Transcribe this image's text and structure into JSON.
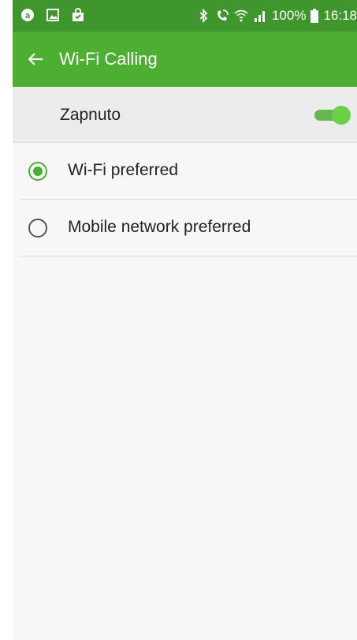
{
  "status_bar": {
    "battery_text": "100%",
    "time": "16:18",
    "icons": [
      "a-app-icon",
      "gallery-icon",
      "shopping-bag-icon",
      "bluetooth-icon",
      "wifi-call-icon",
      "wifi-icon",
      "signal-icon",
      "battery-icon"
    ]
  },
  "app_bar": {
    "title": "Wi-Fi Calling",
    "back_icon": "arrow-left-icon"
  },
  "master_switch": {
    "label": "Zapnuto",
    "on": true
  },
  "options": [
    {
      "label": "Wi-Fi preferred",
      "selected": true
    },
    {
      "label": "Mobile network preferred",
      "selected": false
    }
  ],
  "colors": {
    "status_bar": "#3e962c",
    "app_bar": "#4caf32",
    "accent": "#4caf32",
    "background": "#f7f7f7"
  }
}
